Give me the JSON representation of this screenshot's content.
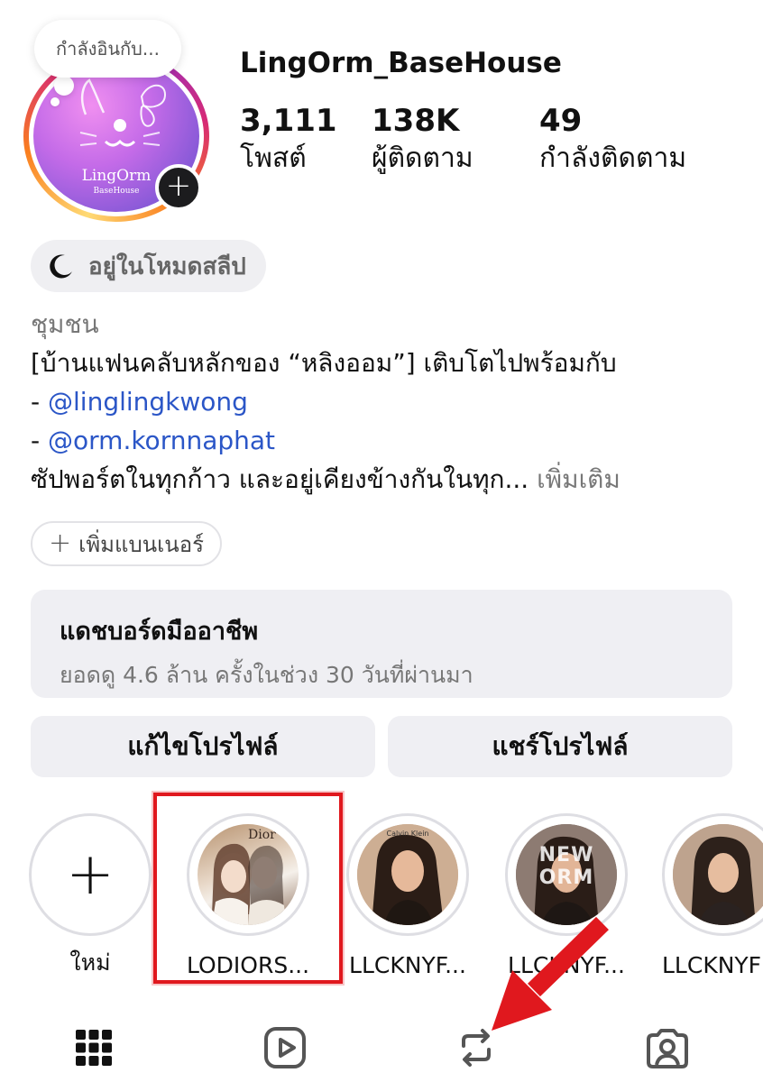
{
  "note": {
    "text": "กำลังอินกับ..."
  },
  "profile": {
    "username": "LingOrm_BaseHouse",
    "avatar_text": "LingOrm",
    "avatar_subtext": "BaseHouse",
    "stats": [
      {
        "value": "3,111",
        "label": "โพสต์"
      },
      {
        "value": "138K",
        "label": "ผู้ติดตาม"
      },
      {
        "value": "49",
        "label": "กำลังติดตาม"
      }
    ]
  },
  "sleep_mode": {
    "icon": "moon-icon",
    "label": "อยู่ในโหมดสลีป"
  },
  "bio": {
    "category": "ชุมชน",
    "line1": "[บ้านแฟนคลับหลักของ “หลิงออม”] เติบโตไปพร้อมกับ",
    "mention1_prefix": "- ",
    "mention1": "@linglingkwong",
    "mention2_prefix": "- ",
    "mention2": "@orm.kornnaphat",
    "line4": "ซัปพอร์ตในทุกก้าว และอยู่เคียงข้างกันในทุก...",
    "more": "เพิ่มเติม"
  },
  "banner_button": {
    "label": "เพิ่มแบนเนอร์"
  },
  "dashboard": {
    "title": "แดชบอร์ดมืออาชีพ",
    "subtitle": "ยอดดู 4.6 ล้าน ครั้งในช่วง 30 วันที่ผ่านมา"
  },
  "actions": {
    "edit_profile": "แก้ไขโปรไฟล์",
    "share_profile": "แชร์โปรไฟล์"
  },
  "highlights": [
    {
      "label": "ใหม่"
    },
    {
      "label": "LODIORS..."
    },
    {
      "label": "LLCKNYF..."
    },
    {
      "label": "LLCKNYF..."
    },
    {
      "label": "LLCKNYF"
    }
  ],
  "highlight_cover_texts": {
    "brand1": "Dior",
    "brand2": "Calvin Klein",
    "brand3": "NEW ORM"
  },
  "tabs": [
    {
      "icon": "grid-icon"
    },
    {
      "icon": "reels-icon"
    },
    {
      "icon": "reposts-icon"
    },
    {
      "icon": "tagged-icon"
    }
  ],
  "colors": {
    "mention": "#2b56c7",
    "annotation_red": "#e0181e",
    "chip_bg": "#efeff3"
  }
}
